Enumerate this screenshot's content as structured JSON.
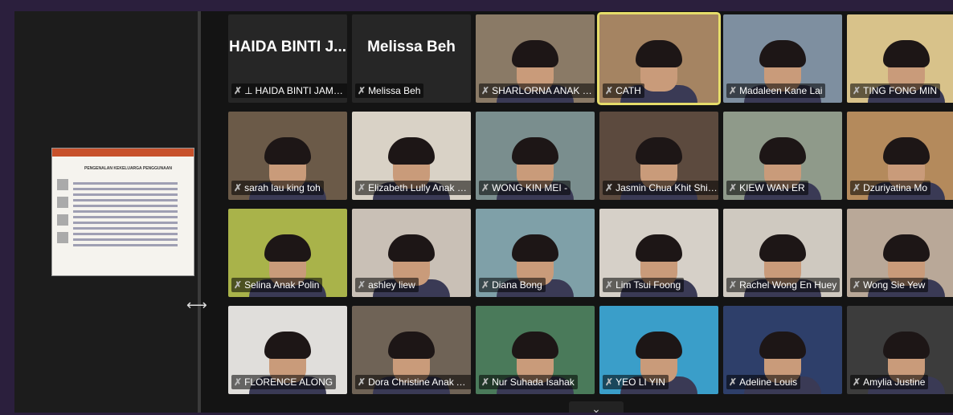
{
  "share_arrow": "⟷",
  "chevron": "⌄",
  "slide": {
    "title": "PENGENALAN KEKELUARGA PENGGUNAAN"
  },
  "participants": [
    {
      "name": "HAIDA BINTI JAMAIL",
      "big": "HAIDA BINTI J...",
      "pinned": true,
      "video": false
    },
    {
      "name": "Melissa Beh",
      "big": "Melissa Beh",
      "video": false
    },
    {
      "name": "SHARLORNA ANAK EA...",
      "bg": "#8a7a66",
      "video": true
    },
    {
      "name": "CATH",
      "bg": "#a58462",
      "video": true,
      "active": true
    },
    {
      "name": "Madaleen Kane Lai",
      "bg": "#7e8fa0",
      "video": true
    },
    {
      "name": "TING FONG MIN",
      "bg": "#d8c28a",
      "video": true
    },
    {
      "name": "sarah lau king toh",
      "bg": "#6b5a48",
      "video": true
    },
    {
      "name": "Elizabeth Lully Anak Fa...",
      "bg": "#d9d2c6",
      "video": true
    },
    {
      "name": "WONG KIN MEI -",
      "bg": "#7a8e8e",
      "video": true
    },
    {
      "name": "Jasmin Chua Khit Shian",
      "bg": "#5c4a3e",
      "video": true
    },
    {
      "name": "KIEW WAN ER",
      "bg": "#8f9a8a",
      "video": true
    },
    {
      "name": "Dzuriyatina Mo",
      "bg": "#b48a5c",
      "video": true
    },
    {
      "name": "Selina Anak Polin",
      "bg": "#a9b34a",
      "video": true
    },
    {
      "name": "ashley liew",
      "bg": "#c9c0b6",
      "video": true
    },
    {
      "name": "Diana Bong",
      "bg": "#7fa0a8",
      "video": true
    },
    {
      "name": "Lim Tsui Foong",
      "bg": "#d6d0c8",
      "video": true
    },
    {
      "name": "Rachel Wong En Huey",
      "bg": "#cfc9c0",
      "video": true
    },
    {
      "name": "Wong Sie Yew",
      "bg": "#b9a898",
      "video": true
    },
    {
      "name": "FLORENCE ALONG",
      "bg": "#e0dedb",
      "video": true
    },
    {
      "name": "Dora Christine Anak Al...",
      "bg": "#6f6356",
      "video": true
    },
    {
      "name": "Nur Suhada Isahak",
      "bg": "#4a7a5a",
      "video": true
    },
    {
      "name": "YEO LI YIN",
      "bg": "#3a9ec9",
      "video": true
    },
    {
      "name": "Adeline Louis",
      "bg": "#2e3f6a",
      "video": true
    },
    {
      "name": "Amylia Justine",
      "bg": "#3c3c3c",
      "video": true
    }
  ],
  "colors": {
    "mic_muted": "#e23a3a",
    "active_speaker": "#e6dd6a"
  }
}
